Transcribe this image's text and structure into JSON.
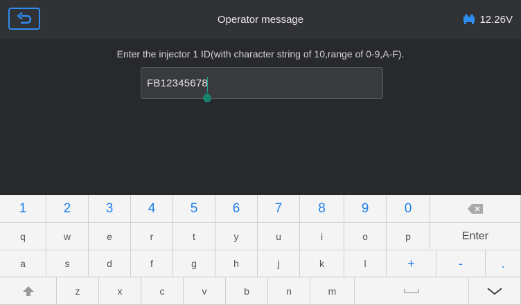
{
  "header": {
    "title": "Operator message",
    "voltage": "12.26V"
  },
  "prompt": "Enter the injector 1 ID(with character string of 10,range of 0-9,A-F).",
  "input": {
    "value": "FB12345678"
  },
  "keyboard": {
    "row1": [
      "1",
      "2",
      "3",
      "4",
      "5",
      "6",
      "7",
      "8",
      "9",
      "0"
    ],
    "row2": [
      "q",
      "w",
      "e",
      "r",
      "t",
      "y",
      "u",
      "i",
      "o",
      "p"
    ],
    "enter": "Enter",
    "row3": [
      "a",
      "s",
      "d",
      "f",
      "g",
      "h",
      "j",
      "k",
      "l"
    ],
    "plus": "+",
    "minus": "-",
    "dot": ".",
    "row4": [
      "z",
      "x",
      "c",
      "v",
      "b",
      "n",
      "m"
    ]
  },
  "colors": {
    "accent": "#1d7fe9",
    "caret": "#16806b"
  }
}
